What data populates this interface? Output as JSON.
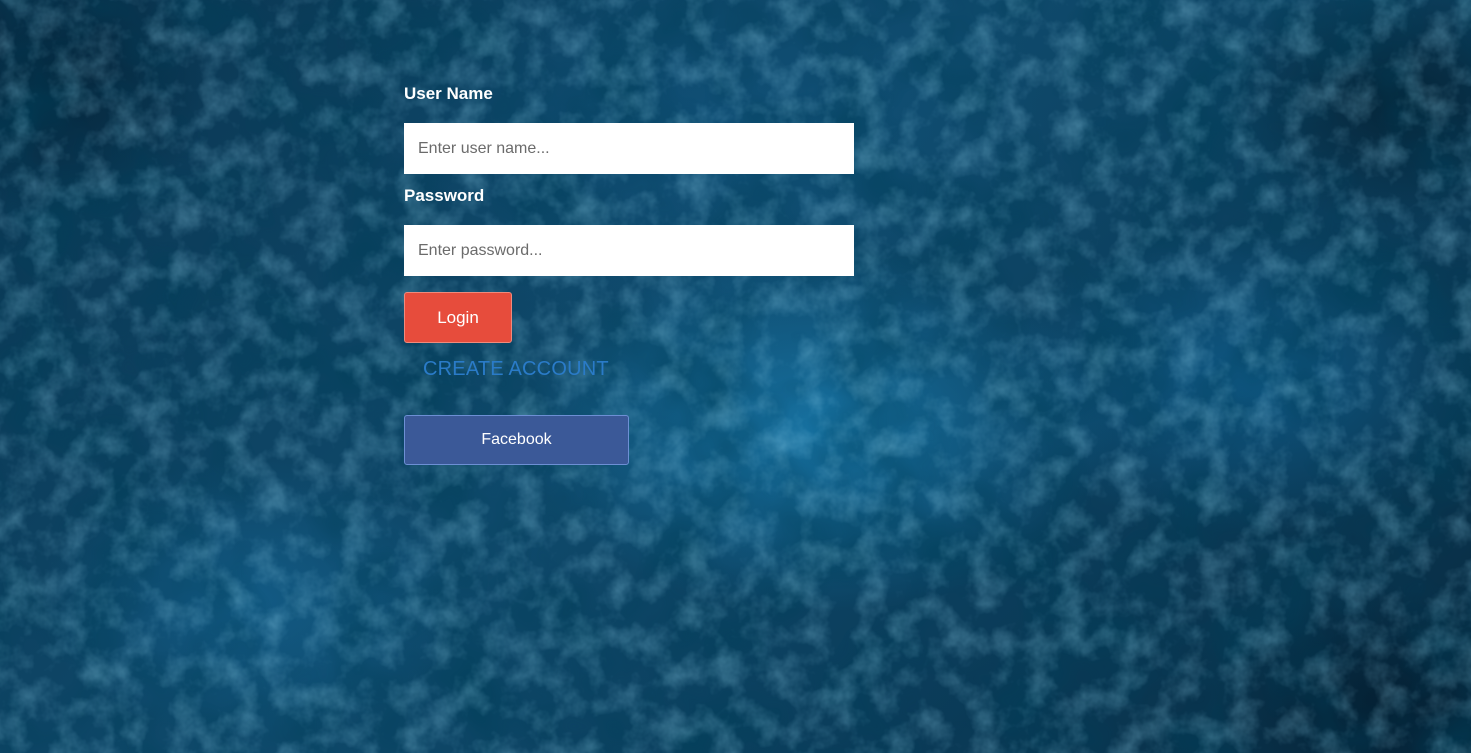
{
  "login_form": {
    "username_label": "User Name",
    "username_placeholder": "Enter user name...",
    "password_label": "Password",
    "password_placeholder": "Enter password...",
    "login_button": "Login",
    "create_account_link": "CREATE ACCOUNT",
    "facebook_button": "Facebook"
  },
  "colors": {
    "background": "#0c3a55",
    "login_button": "#e74c3c",
    "create_account_link": "#2a7bc8",
    "facebook_button": "#3b5998"
  }
}
